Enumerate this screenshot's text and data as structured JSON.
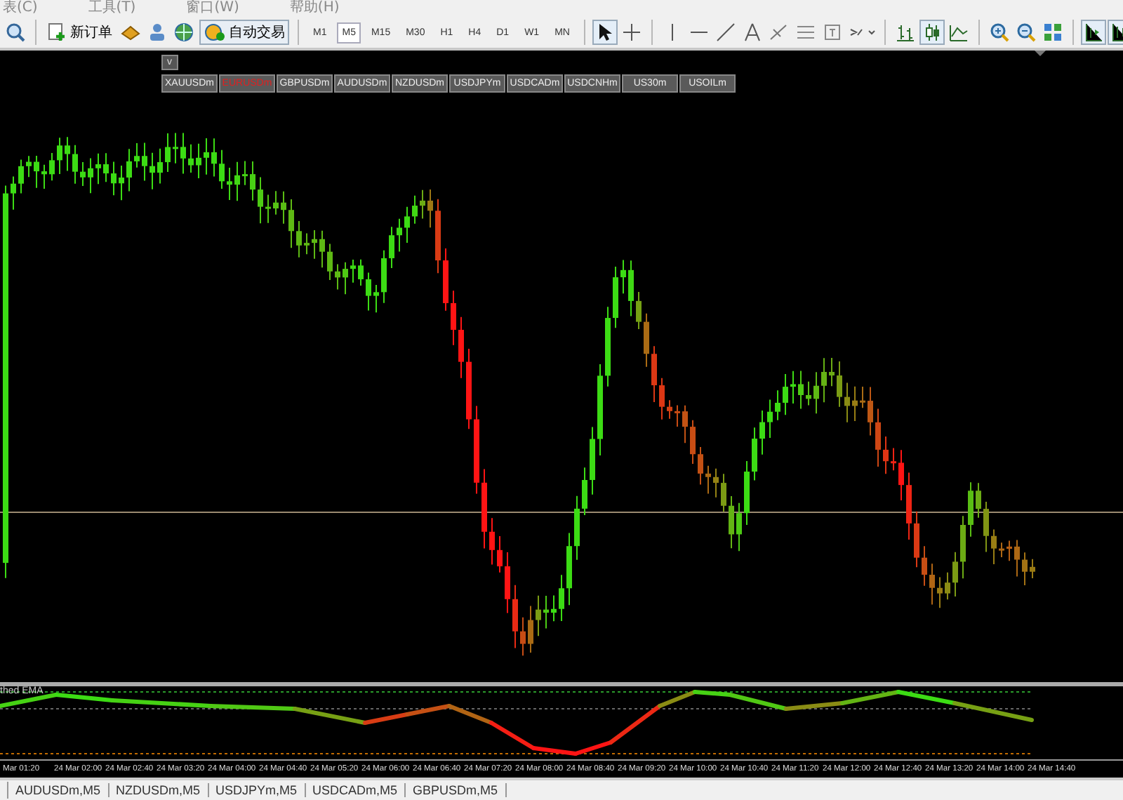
{
  "menu": [
    "表(C)",
    "工具(T)",
    "窗口(W)",
    "帮助(H)"
  ],
  "toolbar": {
    "new_order": "新订单",
    "auto_trading": "自动交易",
    "timeframes": [
      {
        "label": "M1",
        "selected": false
      },
      {
        "label": "M5",
        "selected": true
      },
      {
        "label": "M15",
        "selected": false
      },
      {
        "label": "M30",
        "selected": false
      },
      {
        "label": "H1",
        "selected": false
      },
      {
        "label": "H4",
        "selected": false
      },
      {
        "label": "D1",
        "selected": false
      },
      {
        "label": "W1",
        "selected": false
      },
      {
        "label": "MN",
        "selected": false
      }
    ]
  },
  "symbol_panel": {
    "toggle": "v",
    "symbols": [
      {
        "label": "XAUUSDm",
        "selected": false
      },
      {
        "label": "EURUSDm",
        "selected": true
      },
      {
        "label": "GBPUSDm",
        "selected": false
      },
      {
        "label": "AUDUSDm",
        "selected": false
      },
      {
        "label": "NZDUSDm",
        "selected": false
      },
      {
        "label": "USDJPYm",
        "selected": false
      },
      {
        "label": "USDCADm",
        "selected": false
      },
      {
        "label": "USDCNHm",
        "selected": false
      },
      {
        "label": "US30m",
        "selected": false
      },
      {
        "label": "USOILm",
        "selected": false
      }
    ]
  },
  "indicator": {
    "label": "thed EMA"
  },
  "time_axis": [
    "Mar 01:20",
    "24 Mar 02:00",
    "24 Mar 02:40",
    "24 Mar 03:20",
    "24 Mar 04:00",
    "24 Mar 04:40",
    "24 Mar 05:20",
    "24 Mar 06:00",
    "24 Mar 06:40",
    "24 Mar 07:20",
    "24 Mar 08:00",
    "24 Mar 08:40",
    "24 Mar 09:20",
    "24 Mar 10:00",
    "24 Mar 10:40",
    "24 Mar 11:20",
    "24 Mar 12:00",
    "24 Mar 12:40",
    "24 Mar 13:20",
    "24 Mar 14:00",
    "24 Mar 14:40"
  ],
  "chart_tabs": [
    "AUDUSDm,M5",
    "NZDUSDm,M5",
    "USDJPYm,M5",
    "USDCADm,M5",
    "GBPUSDm,M5"
  ]
}
